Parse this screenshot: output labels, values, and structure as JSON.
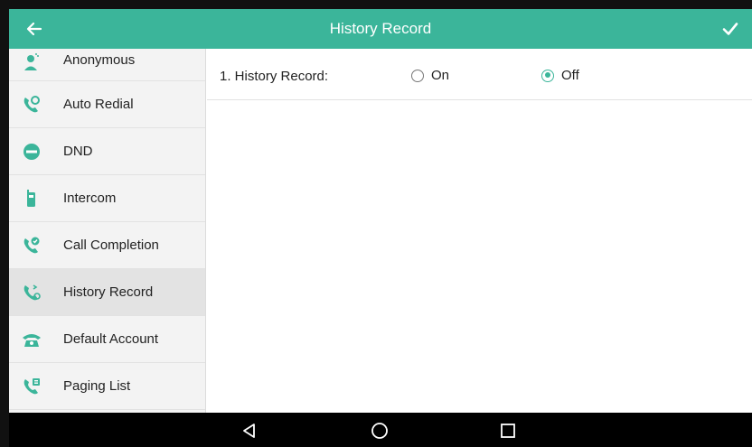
{
  "header": {
    "title": "History Record",
    "back_icon": "arrow-left-icon",
    "confirm_icon": "checkmark-icon",
    "bar_color": "#3bb59a"
  },
  "sidebar": {
    "items": [
      {
        "label": "Anonymous",
        "icon": "anonymous-icon"
      },
      {
        "label": "Auto Redial",
        "icon": "auto-redial-icon"
      },
      {
        "label": "DND",
        "icon": "dnd-icon"
      },
      {
        "label": "Intercom",
        "icon": "intercom-icon"
      },
      {
        "label": "Call Completion",
        "icon": "call-completion-icon"
      },
      {
        "label": "History Record",
        "icon": "history-record-icon",
        "active": true
      },
      {
        "label": "Default Account",
        "icon": "default-account-icon"
      },
      {
        "label": "Paging List",
        "icon": "paging-list-icon"
      }
    ]
  },
  "main": {
    "field_label": "1. History Record:",
    "options": [
      {
        "label": "On",
        "selected": false
      },
      {
        "label": "Off",
        "selected": true
      }
    ]
  },
  "navbar": {
    "buttons": [
      "back-triangle-icon",
      "home-circle-icon",
      "recents-square-icon"
    ]
  }
}
